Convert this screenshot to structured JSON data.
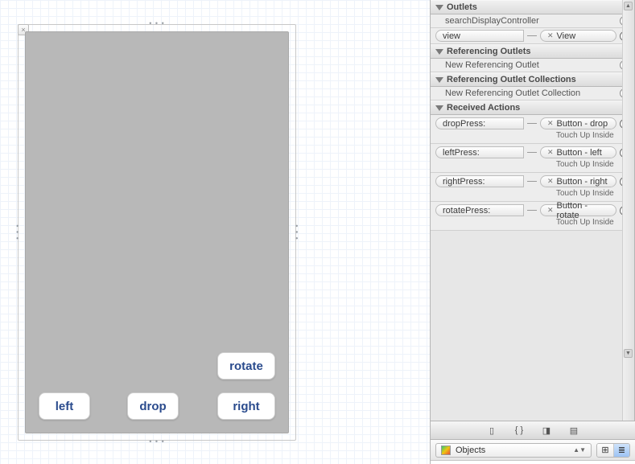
{
  "canvas": {
    "buttons": {
      "rotate": "rotate",
      "left": "left",
      "drop": "drop",
      "right": "right"
    },
    "close_glyph": "×"
  },
  "inspector": {
    "sections": {
      "outlets": {
        "title": "Outlets",
        "rows": [
          {
            "name": "searchDisplayController",
            "connected": false
          },
          {
            "name": "view",
            "connected": true,
            "target": "View"
          }
        ]
      },
      "referencing_outlets": {
        "title": "Referencing Outlets",
        "placeholder": "New Referencing Outlet"
      },
      "referencing_collections": {
        "title": "Referencing Outlet Collections",
        "placeholder": "New Referencing Outlet Collection"
      },
      "received_actions": {
        "title": "Received Actions",
        "rows": [
          {
            "name": "dropPress:",
            "target": "Button - drop",
            "event": "Touch Up Inside"
          },
          {
            "name": "leftPress:",
            "target": "Button - left",
            "event": "Touch Up Inside"
          },
          {
            "name": "rightPress:",
            "target": "Button - right",
            "event": "Touch Up Inside"
          },
          {
            "name": "rotatePress:",
            "target": "Button - rotate",
            "event": "Touch Up Inside"
          }
        ]
      }
    }
  },
  "bottom_tabs": {
    "file_icon": "▯",
    "code_icon": "{ }",
    "cube_icon": "◨",
    "media_icon": "▤"
  },
  "library": {
    "label": "Objects",
    "view_modes": {
      "grid": "⊞",
      "list": "≣"
    }
  }
}
